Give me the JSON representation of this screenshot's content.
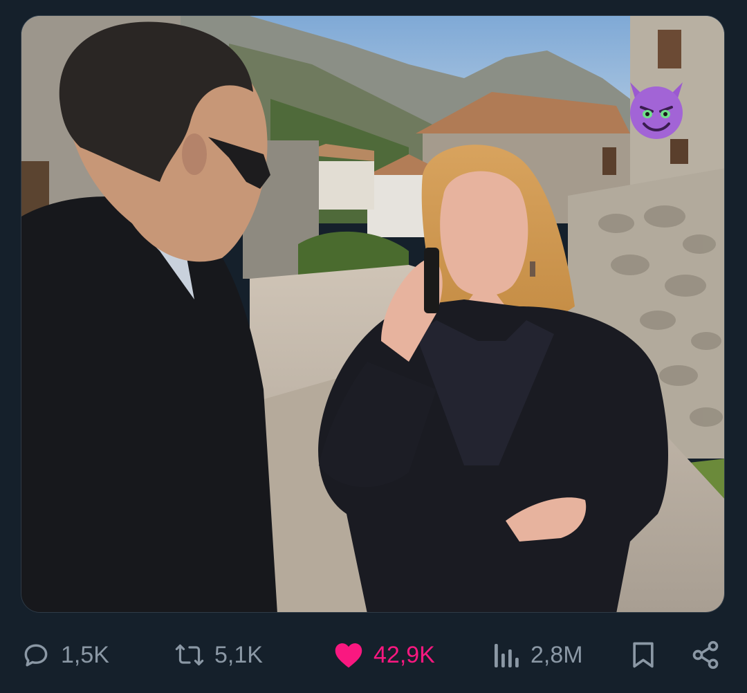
{
  "post": {
    "media": {
      "alt": "",
      "overlay_emoji": "smiling-face-with-horns"
    },
    "actions": {
      "reply": {
        "icon": "reply-icon",
        "count": "1,5K"
      },
      "retweet": {
        "icon": "retweet-icon",
        "count": "5,1K"
      },
      "like": {
        "icon": "heart-icon",
        "count": "42,9K",
        "liked": true,
        "color": "#f91880"
      },
      "views": {
        "icon": "views-icon",
        "count": "2,8M"
      },
      "bookmark": {
        "icon": "bookmark-icon"
      },
      "share": {
        "icon": "share-icon"
      }
    }
  },
  "colors": {
    "background": "#15202b",
    "muted_text": "#8b98a5",
    "like": "#f91880"
  }
}
